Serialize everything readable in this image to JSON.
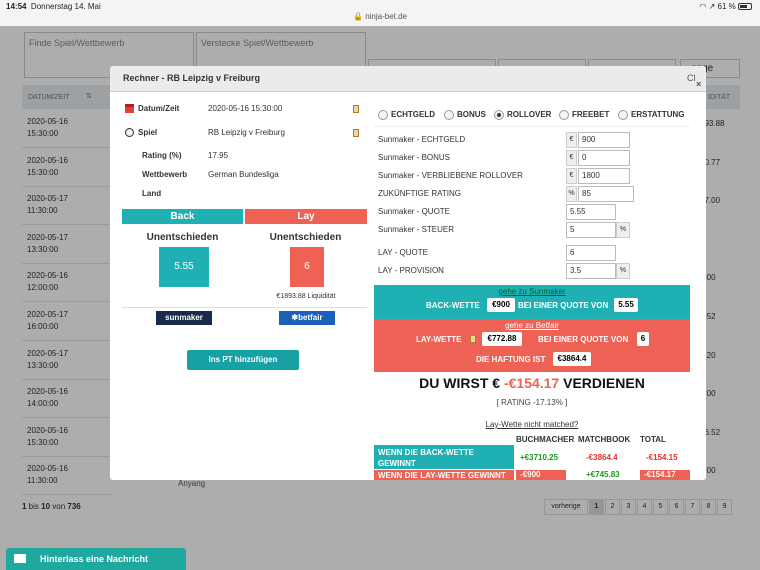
{
  "status": {
    "time": "14:54",
    "date": "Donnerstag 14. Mai",
    "battery": "61 %",
    "url": "ninja-bet.de"
  },
  "page": {
    "search_placeholder": "Finde Spiel/Wettbewerb",
    "hide_placeholder": "Verstecke Spiel/Wettbewerb",
    "change_label": "ange",
    "col_date": "DATUM/ZEIT",
    "col_liq": "IDITÄT",
    "rows": [
      {
        "date": "2020-05-16",
        "time": "15:30:00",
        "right": "893.88"
      },
      {
        "date": "2020-05-16",
        "time": "15:30:00",
        "right": "00.77"
      },
      {
        "date": "2020-05-17",
        "time": "11:30:00",
        "right": "57.00"
      },
      {
        "date": "2020-05-17",
        "time": "13:30:00",
        "right": "3"
      },
      {
        "date": "2020-05-16",
        "time": "12:00:00",
        "right": "3.00"
      },
      {
        "date": "2020-05-17",
        "time": "16:00:00",
        "right": "9.52"
      },
      {
        "date": "2020-05-17",
        "time": "13:30:00",
        "right": "1.20"
      },
      {
        "date": "2020-05-16",
        "time": "14:00:00",
        "right": "1.00"
      },
      {
        "date": "2020-05-16",
        "time": "15:30:00",
        "right": "16.52"
      },
      {
        "date": "2020-05-16",
        "time": "11:30:00",
        "right": "9.00"
      }
    ],
    "row_extra": "Anyang",
    "count_text_pre": "1",
    "count_text_mid": " bis ",
    "count_to": "10",
    "count_of": " von ",
    "count_total": "736",
    "pager": {
      "prev": "vorherige",
      "pages": [
        "1",
        "2",
        "3",
        "4",
        "5",
        "6",
        "7",
        "8",
        "9"
      ],
      "active": "1"
    },
    "chat_label": "Hinterlass eine Nachricht"
  },
  "modal": {
    "title": "Rechner - RB Leipzig v Freiburg",
    "close": "Cl",
    "info": {
      "date_label": "Datum/Zeit",
      "date_value": "2020-05-16 15:30:00",
      "game_label": "Spiel",
      "game_value": "RB Leipzig v Freiburg",
      "rating_label": "Rating (%)",
      "rating_value": "17.95",
      "comp_label": "Wettbewerb",
      "comp_value": "German Bundesliga",
      "country_label": "Land",
      "country_value": ""
    },
    "back": {
      "header": "Back",
      "selection": "Unentschieden",
      "odds": "5.55",
      "brand": "sunmaker"
    },
    "lay": {
      "header": "Lay",
      "selection": "Unentschieden",
      "odds": "6",
      "liquidity": "€1893.88 Liquidität",
      "brand": "betfair"
    },
    "add_button": "Ins PT hinzufügen",
    "modes": [
      {
        "label": "ECHTGELD",
        "on": false
      },
      {
        "label": "BONUS",
        "on": false
      },
      {
        "label": "ROLLOVER",
        "on": true
      },
      {
        "label": "FREEBET",
        "on": false
      },
      {
        "label": "ERSTATTUNG",
        "on": false
      }
    ],
    "fields": {
      "stake_label": "Sunmaker - ECHTGELD",
      "stake_prefix": "€",
      "stake_value": "900",
      "bonus_label": "Sunmaker - BONUS",
      "bonus_prefix": "€",
      "bonus_value": "0",
      "rollover_label": "Sunmaker - VERBLIEBENE ROLLOVER",
      "rollover_prefix": "€",
      "rollover_value": "1800",
      "future_label": "ZUKÜNFTIGE RATING",
      "future_prefix": "%",
      "future_value": "85",
      "quote_label": "Sunmaker - QUOTE",
      "quote_value": "5.55",
      "tax_label": "Sunmaker - STEUER",
      "tax_value": "5",
      "tax_suffix": "%",
      "lay_quote_label": "LAY - QUOTE",
      "lay_quote_value": "6",
      "lay_prov_label": "LAY - PROVISION",
      "lay_prov_value": "3.5",
      "lay_prov_suffix": "%"
    },
    "instr": {
      "back_link": "gehe zu Sunmaker",
      "back_label": "BACK-WETTE",
      "back_amount": "€900",
      "back_mid": "BEI EINER QUOTE VON",
      "back_odds": "5.55",
      "lay_link": "gehe zu Betfair",
      "lay_label": "LAY-WETTE",
      "lay_amount": "€772.88",
      "lay_mid": "BEI EINER QUOTE VON",
      "lay_odds": "6",
      "liab_label": "DIE HAFTUNG IST",
      "liab_amount": "€3864.4"
    },
    "result": {
      "pre": "DU WIRST € ",
      "amount": "-€154.17",
      "post": " VERDIENEN",
      "rating": "[ RATING -17.13% ]"
    },
    "unmatched_link": "Lay-Wette nicht matched?",
    "table": {
      "headers": [
        "BUCHMACHER",
        "MATCHBOOK",
        "TOTAL"
      ],
      "row1_label": "WENN DIE BACK-WETTE GEWINNT",
      "row1": [
        "+€3710.25",
        "-€3864.4",
        "-€154.15"
      ],
      "row2_label": "WENN DIE LAY-WETTE GEWINNT",
      "row2": [
        "-€900",
        "+€745.83",
        "-€154.17"
      ]
    }
  },
  "colors": {
    "teal": "#1fb0b4",
    "red": "#ee6155",
    "negative": "#e03030",
    "positive": "#1a9a1a"
  }
}
